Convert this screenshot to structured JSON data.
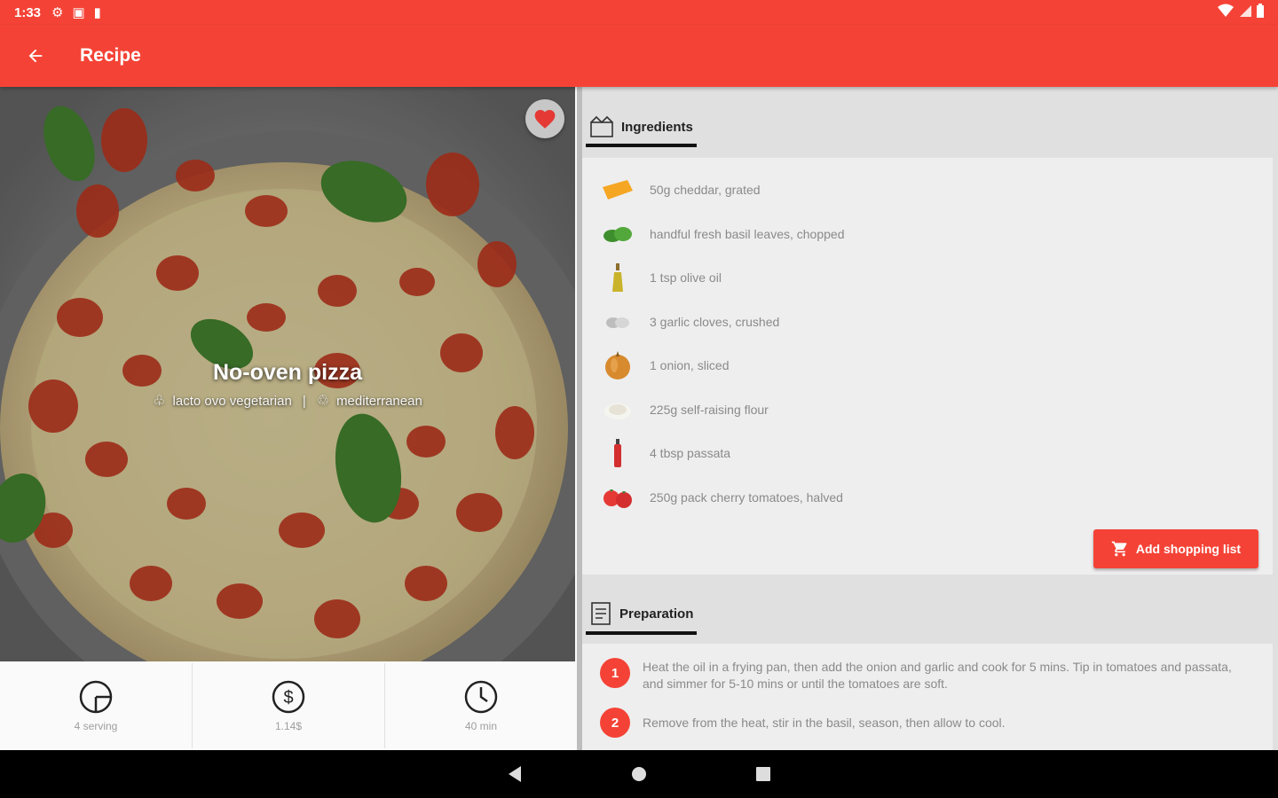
{
  "status_bar": {
    "time": "1:33",
    "icons": [
      "settings-icon",
      "notification-icon",
      "sd-card-icon"
    ],
    "right_icons": [
      "wifi-icon",
      "signal-icon",
      "battery-icon"
    ]
  },
  "app_bar": {
    "title": "Recipe",
    "back_icon": "arrow-back-icon",
    "color": "#f44336"
  },
  "recipe": {
    "name": "No-oven pizza",
    "diet": "lacto ovo vegetarian",
    "separator": "|",
    "cuisine": "mediterranean",
    "favorite": true
  },
  "stats": [
    {
      "icon": "pie-chart-icon",
      "label": "4 serving"
    },
    {
      "icon": "dollar-icon",
      "label": "1.14$"
    },
    {
      "icon": "clock-icon",
      "label": "40 min"
    }
  ],
  "ingredients_section": {
    "title": "Ingredients",
    "items": [
      {
        "icon": "cheese-icon",
        "text": "50g cheddar, grated"
      },
      {
        "icon": "basil-icon",
        "text": "handful fresh basil leaves, chopped"
      },
      {
        "icon": "olive-oil-icon",
        "text": "1 tsp olive oil"
      },
      {
        "icon": "garlic-icon",
        "text": "3 garlic cloves, crushed"
      },
      {
        "icon": "onion-icon",
        "text": "1 onion, sliced"
      },
      {
        "icon": "flour-icon",
        "text": "225g self-raising flour"
      },
      {
        "icon": "passata-icon",
        "text": "4 tbsp passata"
      },
      {
        "icon": "tomato-icon",
        "text": "250g pack cherry tomatoes, halved"
      }
    ],
    "button_label": "Add shopping list"
  },
  "preparation_section": {
    "title": "Preparation",
    "steps": [
      {
        "number": "1",
        "text": "Heat the oil in a frying pan, then add the onion and garlic and cook for 5 mins. Tip in tomatoes and passata, and simmer for 5-10 mins or until the tomatoes are soft."
      },
      {
        "number": "2",
        "text": "Remove from the heat, stir in the basil, season, then allow to cool."
      }
    ]
  },
  "nav_bar": {
    "buttons": [
      "back-triangle-icon",
      "home-circle-icon",
      "recents-square-icon"
    ]
  }
}
